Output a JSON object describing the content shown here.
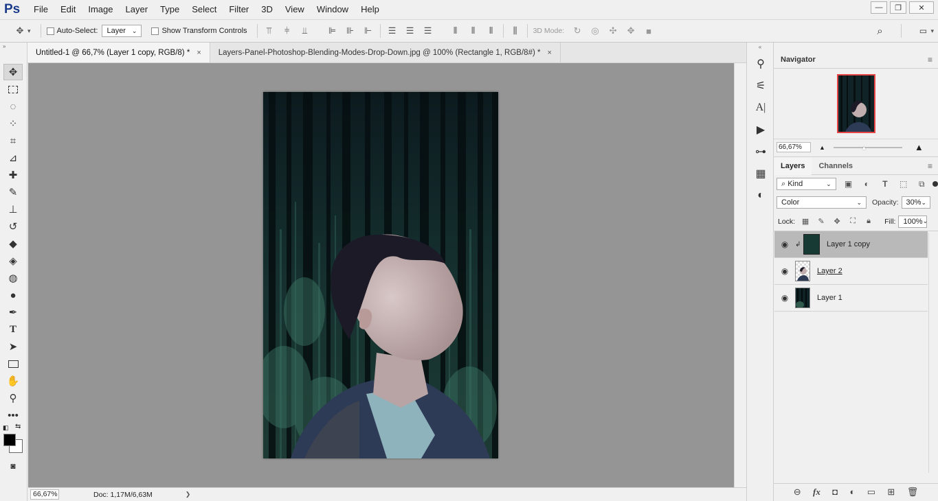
{
  "app": {
    "logo": "Ps"
  },
  "menu": [
    "File",
    "Edit",
    "Image",
    "Layer",
    "Type",
    "Select",
    "Filter",
    "3D",
    "View",
    "Window",
    "Help"
  ],
  "window_controls": {
    "minimize": "—",
    "restore": "❐",
    "close": "✕"
  },
  "options": {
    "auto_select_label": "Auto-Select:",
    "auto_select_value": "Layer",
    "show_transform_label": "Show Transform Controls",
    "mode_3d_label": "3D Mode:"
  },
  "tabs": [
    {
      "title": "Untitled-1 @ 66,7% (Layer 1 copy, RGB/8) *",
      "close": "×"
    },
    {
      "title": "Layers-Panel-Photoshop-Blending-Modes-Drop-Down.jpg @ 100% (Rectangle 1, RGB/8#) *",
      "close": "×"
    }
  ],
  "status": {
    "zoom": "66,67%",
    "doc": "Doc: 1,17M/6,63M",
    "arrow": "❯"
  },
  "navigator": {
    "title": "Navigator",
    "zoom": "66,67%"
  },
  "layers_panel": {
    "tab_layers": "Layers",
    "tab_channels": "Channels",
    "filter_kind": "Kind",
    "blend_mode": "Color",
    "opacity_label": "Opacity:",
    "opacity_value": "30%",
    "lock_label": "Lock:",
    "fill_label": "Fill:",
    "fill_value": "100%",
    "layers": [
      {
        "name": "Layer 1 copy",
        "selected": true
      },
      {
        "name": "Layer 2",
        "selected": false
      },
      {
        "name": "Layer 1",
        "selected": false
      }
    ]
  },
  "colors": {
    "accent_canvas": "#959595",
    "selected_layer": "#b9b9b9",
    "ps_logo": "#1a3a8a"
  }
}
